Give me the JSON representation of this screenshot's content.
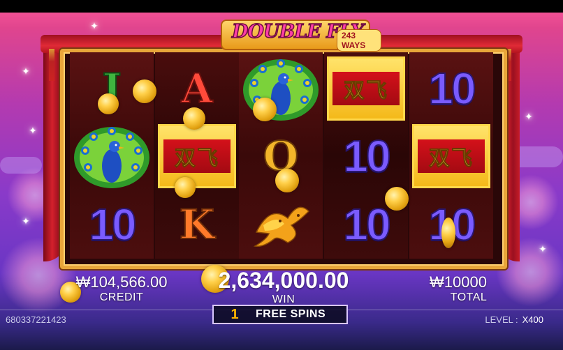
{
  "game": {
    "title": "DOUBLE FLY",
    "ways": "243 WAYS",
    "wild_symbol_text": "双飞"
  },
  "reels": [
    {
      "name": "reel-1",
      "symbols": [
        "J",
        "peacock",
        "10"
      ]
    },
    {
      "name": "reel-2",
      "symbols": [
        "A",
        "wild",
        "K"
      ]
    },
    {
      "name": "reel-3",
      "symbols": [
        "peacock",
        "Q",
        "birds"
      ]
    },
    {
      "name": "reel-4",
      "symbols": [
        "wild",
        "10",
        "10"
      ]
    },
    {
      "name": "reel-5",
      "symbols": [
        "10",
        "wild",
        "10"
      ]
    }
  ],
  "hud": {
    "credit_value": "₩104,566.00",
    "credit_label": "CREDIT",
    "win_value": "2,634,000.00",
    "win_label": "WIN",
    "total_value": "₩10000",
    "total_label": "TOTAL",
    "free_spins_count": "1",
    "free_spins_label": "FREE SPINS",
    "player_id": "680337221423",
    "level_label": "LEVEL :",
    "level_value": "X400"
  },
  "colors": {
    "accent_gold": "#e8a63a",
    "curtain_red": "#d4202c",
    "ten_purple": "#7a5bff",
    "freespin_orange": "#ffb400"
  }
}
